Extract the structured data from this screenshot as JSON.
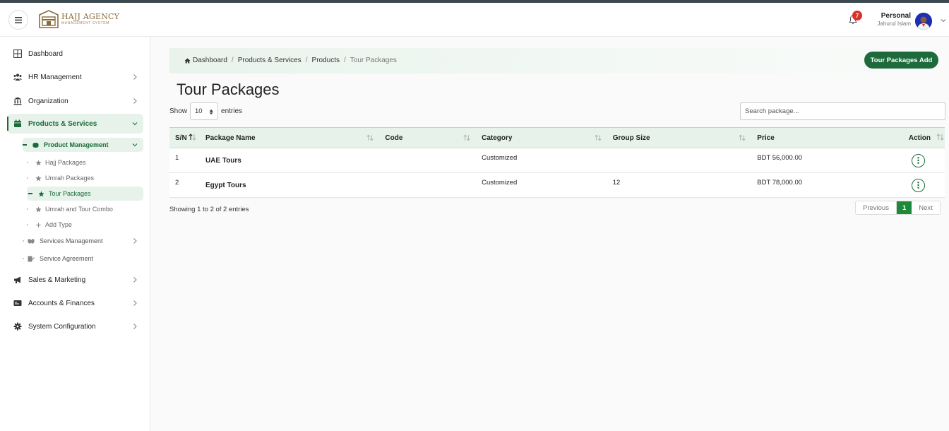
{
  "app": {
    "logo_title": "HAJJ AGENCY",
    "logo_subtitle": "MANAGEMENT SYSTEM",
    "notification_count": "7",
    "user_role": "Personal",
    "user_name": "Jahurul Islam"
  },
  "sidebar": {
    "items": [
      {
        "label": "Dashboard",
        "icon": "grid-icon"
      },
      {
        "label": "HR Management",
        "icon": "users-icon"
      },
      {
        "label": "Organization",
        "icon": "bank-icon"
      },
      {
        "label": "Products & Services",
        "icon": "calendar-icon",
        "active": true
      },
      {
        "label": "Sales & Marketing",
        "icon": "megaphone-icon"
      },
      {
        "label": "Accounts & Finances",
        "icon": "card-icon"
      },
      {
        "label": "System Configuration",
        "icon": "gear-icon"
      }
    ],
    "product_management": "Product Management",
    "leaves": [
      "Hajj Packages",
      "Umrah Packages",
      "Tour Packages",
      "Umrah and Tour Combo",
      "Add Type"
    ],
    "services_management": "Services Management",
    "service_agreement": "Service Agreement"
  },
  "breadcrumb": [
    "Dashboard",
    "Products & Services",
    "Products",
    "Tour Packages"
  ],
  "add_button": "Tour Packages Add",
  "page_title": "Tour Packages",
  "controls": {
    "show_label": "Show",
    "entries_value": "10",
    "entries_label": "entries",
    "search_placeholder": "Search package..."
  },
  "table": {
    "columns": [
      "S/N",
      "Package Name",
      "Code",
      "Category",
      "Group Size",
      "Price",
      "Action"
    ],
    "rows": [
      {
        "sn": "1",
        "name": "UAE Tours",
        "code": "",
        "category": "Customized",
        "group_size": "",
        "price": "BDT 56,000.00"
      },
      {
        "sn": "2",
        "name": "Egypt Tours",
        "code": "",
        "category": "Customized",
        "group_size": "12",
        "price": "BDT 78,000.00"
      }
    ]
  },
  "footer": {
    "info": "Showing 1 to 2 of 2 entries",
    "previous": "Previous",
    "current_page": "1",
    "next": "Next"
  },
  "colors": {
    "brand": "#1d6b3a",
    "active_bg": "#e6f2ea",
    "badge": "#d9312b"
  }
}
